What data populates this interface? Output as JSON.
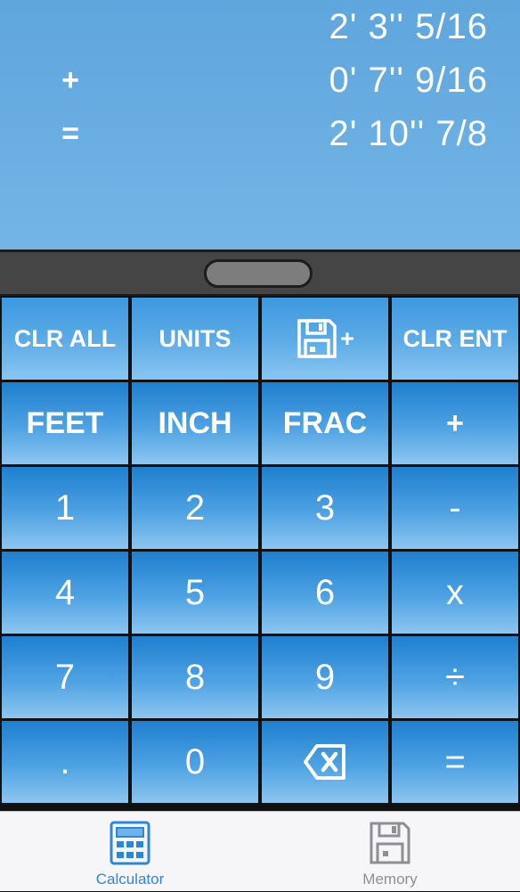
{
  "display": {
    "lines": [
      {
        "operator": "",
        "value": "2' 3'' 5/16"
      },
      {
        "operator": "+",
        "value": "0' 7'' 9/16"
      },
      {
        "operator": "=",
        "value": "2' 10'' 7/8"
      }
    ]
  },
  "keys": {
    "clr_all": "CLR ALL",
    "units": "UNITS",
    "save_plus": "+",
    "clr_ent": "CLR ENT",
    "feet": "FEET",
    "inch": "INCH",
    "frac": "FRAC",
    "plus": "+",
    "one": "1",
    "two": "2",
    "three": "3",
    "minus": "-",
    "four": "4",
    "five": "5",
    "six": "6",
    "multiply": "x",
    "seven": "7",
    "eight": "8",
    "nine": "9",
    "divide": "÷",
    "decimal": ".",
    "zero": "0",
    "equals": "="
  },
  "tabs": {
    "calculator": "Calculator",
    "memory": "Memory"
  },
  "colors": {
    "tab_active": "#2f86d6",
    "tab_inactive": "#8e8e93"
  }
}
